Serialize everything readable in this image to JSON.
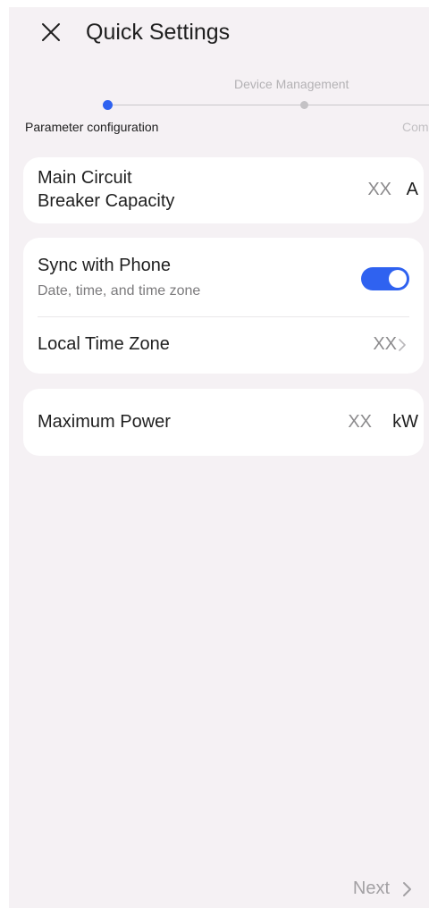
{
  "header": {
    "title": "Quick Settings",
    "close_icon": "close-icon"
  },
  "stepper": {
    "steps": [
      {
        "label": "Parameter configuration",
        "state": "active"
      },
      {
        "label": "Device Management",
        "state": "inactive"
      },
      {
        "label": "Com",
        "state": "inactive"
      }
    ],
    "active_color": "#2f62f0",
    "inactive_color": "#c4c2c5"
  },
  "breaker": {
    "label_line1": "Main Circuit",
    "label_line2": "Breaker Capacity",
    "value": "XX",
    "unit": "A"
  },
  "sync": {
    "label": "Sync with Phone",
    "sublabel": "Date, time, and time zone",
    "enabled": true,
    "toggle_color": "#2f62f0"
  },
  "timezone": {
    "label": "Local Time Zone",
    "value": "XX",
    "chevron_icon": "chevron-right-icon"
  },
  "power": {
    "label": "Maximum Power",
    "value": "XX",
    "unit": "kW"
  },
  "footer": {
    "next_label": "Next",
    "chevron_icon": "chevron-right-icon"
  }
}
